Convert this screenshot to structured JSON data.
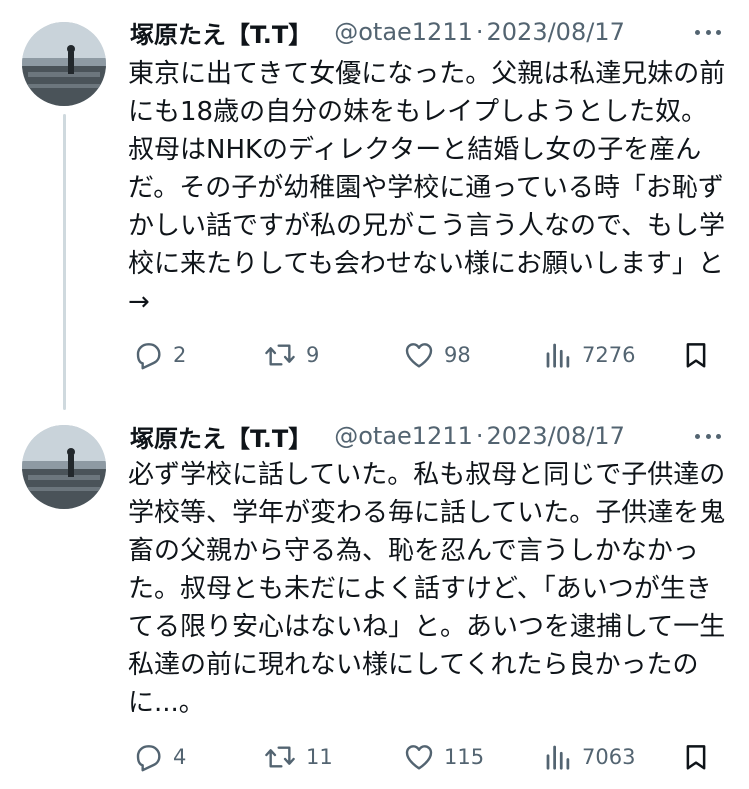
{
  "tweets": [
    {
      "author": {
        "name": "塚原たえ【T.T】",
        "handle": "@otae1211",
        "separator": "·",
        "date": "2023/08/17"
      },
      "text": "東京に出てきて女優になった。父親は私達兄妹の前にも18歳の自分の妹をもレイプしようとした奴。叔母はNHKのディレクターと結婚し女の子を産んだ。その子が幼稚園や学校に通っている時「お恥ずかしい話ですが私の兄がこう言う人なので、もし学校に来たりしても会わせない様にお願いします」と →",
      "stats": {
        "replies": "2",
        "retweets": "9",
        "likes": "98",
        "views": "7276"
      }
    },
    {
      "author": {
        "name": "塚原たえ【T.T】",
        "handle": "@otae1211",
        "separator": "·",
        "date": "2023/08/17"
      },
      "text": "必ず学校に話していた。私も叔母と同じで子供達の学校等、学年が変わる毎に話していた。子供達を鬼畜の父親から守る為、恥を忍んで言うしかなかった。叔母とも未だによく話すけど、「あいつが生きてる限り安心はないね」と。あいつを逮捕して一生私達の前に現れない様にしてくれたら良かったのに...。",
      "stats": {
        "replies": "4",
        "retweets": "11",
        "likes": "115",
        "views": "7063"
      }
    }
  ],
  "colors": {
    "text": "#0f1419",
    "secondary": "#536471",
    "thread_line": "#cfd9de",
    "background": "#ffffff"
  },
  "icons": [
    "reply-icon",
    "retweet-icon",
    "like-icon",
    "views-icon",
    "bookmark-icon",
    "more-icon"
  ]
}
